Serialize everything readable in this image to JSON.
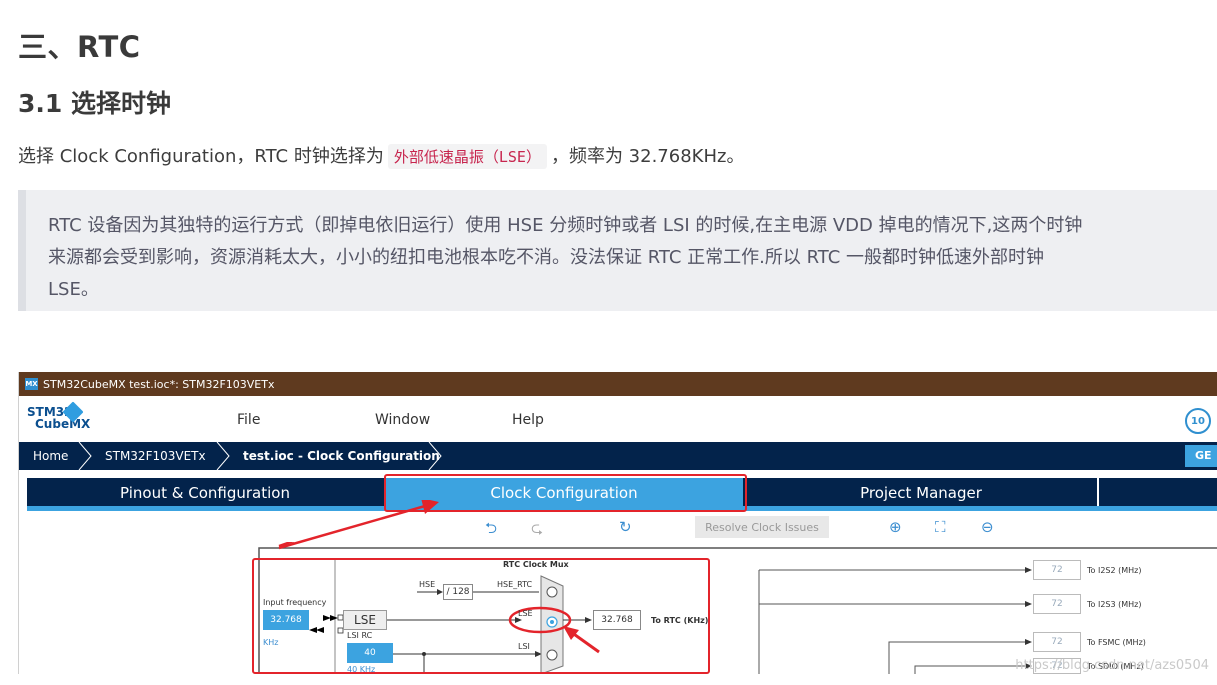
{
  "article": {
    "h2": "三、RTC",
    "h3": "3.1 选择时钟",
    "para_before": "选择 Clock Configuration，RTC 时钟选择为",
    "para_code": "外部低速晶振（LSE）",
    "para_after": "，频率为 32.768KHz。",
    "quote_line1": "RTC 设备因为其独特的运行方式（即掉电依旧运行）使用 HSE 分频时钟或者 LSI 的时候,在主电源 VDD 掉电的情况下,这两个时钟",
    "quote_line2": "来源都会受到影响，资源消耗太大，小小的纽扣电池根本吃不消。没法保证 RTC 正常工作.所以 RTC 一般都时钟低速外部时钟",
    "quote_line3": "LSE。"
  },
  "app": {
    "logo_mark": "MX",
    "window_title": "STM32CubeMX test.ioc*: STM32F103VETx",
    "brand_line1": "STM32",
    "brand_line2": "CubeMX",
    "badge": "10",
    "menu": [
      "File",
      "Window",
      "Help"
    ],
    "breadcrumbs": [
      "Home",
      "STM32F103VETx",
      "test.ioc - Clock Configuration"
    ],
    "generate_label": "GE",
    "tabs": [
      "Pinout & Configuration",
      "Clock Configuration",
      "Project Manager"
    ],
    "active_tab": 1,
    "resolve_label": "Resolve Clock Issues"
  },
  "diagram": {
    "mux_title": "RTC Clock Mux",
    "input_freq_label": "Input frequency",
    "input_freq_value": "32.768",
    "input_freq_unit": "KHz",
    "lse_label": "LSE",
    "lsi_rc_label": "LSI RC",
    "lsi_value": "40",
    "lsi_unit": "40 KHz",
    "hse_label": "HSE",
    "hse_div": "/ 128",
    "hse_rtc_label": "HSE_RTC",
    "lse_line_label": "LSE",
    "lsi_line_label": "LSI",
    "rtc_value": "32.768",
    "rtc_label": "To RTC (KHz)",
    "right_outputs": [
      {
        "value": "72",
        "label": "To I2S2 (MHz)"
      },
      {
        "value": "72",
        "label": "To I2S3 (MHz)"
      },
      {
        "value": "72",
        "label": "To FSMC (MHz)"
      },
      {
        "value": "72",
        "label": "To SDIO (MHz)"
      }
    ]
  },
  "watermark": "https://blog.csdn.net/azs0504",
  "colors": {
    "titlebar": "#5f3a1f",
    "navy": "#03234b",
    "accent": "#3ca3e0",
    "highlight": "#e3242b",
    "code_text": "#c7254e"
  }
}
